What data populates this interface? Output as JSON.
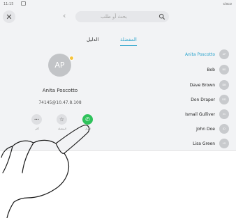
{
  "status": {
    "time": "11:15",
    "brand": "cisco"
  },
  "header": {
    "close_glyph": "✕",
    "back_glyph": "‹",
    "search_placeholder": "بحث أو طلب"
  },
  "tabs": [
    {
      "label": "الدليل"
    },
    {
      "label": "المفضلة"
    }
  ],
  "selected_contact": {
    "initials": "AP",
    "name": "Anita Poscotto",
    "address": "74145@10.47.8.108",
    "favorite_badge_color": "#f5c33b"
  },
  "actions": {
    "more_glyph": "•••",
    "favorite_glyph": "☆",
    "call_glyph": "✆",
    "more_label": "أكثر",
    "favorite_label": "المفضلة",
    "call_label": "اتصال"
  },
  "contacts": [
    {
      "name": "Anita Poscotto",
      "initials": "AP",
      "active": true
    },
    {
      "name": "Bob",
      "initials": "BO",
      "active": false
    },
    {
      "name": "Dave Brown",
      "initials": "DB",
      "active": false
    },
    {
      "name": "Don Draper",
      "initials": "DD",
      "active": false
    },
    {
      "name": "Ismail Gulliver",
      "initials": "IG",
      "active": false
    },
    {
      "name": "John Doe",
      "initials": "JD",
      "active": false
    },
    {
      "name": "Lisa Green",
      "initials": "LG",
      "active": false
    }
  ],
  "colors": {
    "accent": "#29a3cc",
    "call": "#2fc25b"
  }
}
